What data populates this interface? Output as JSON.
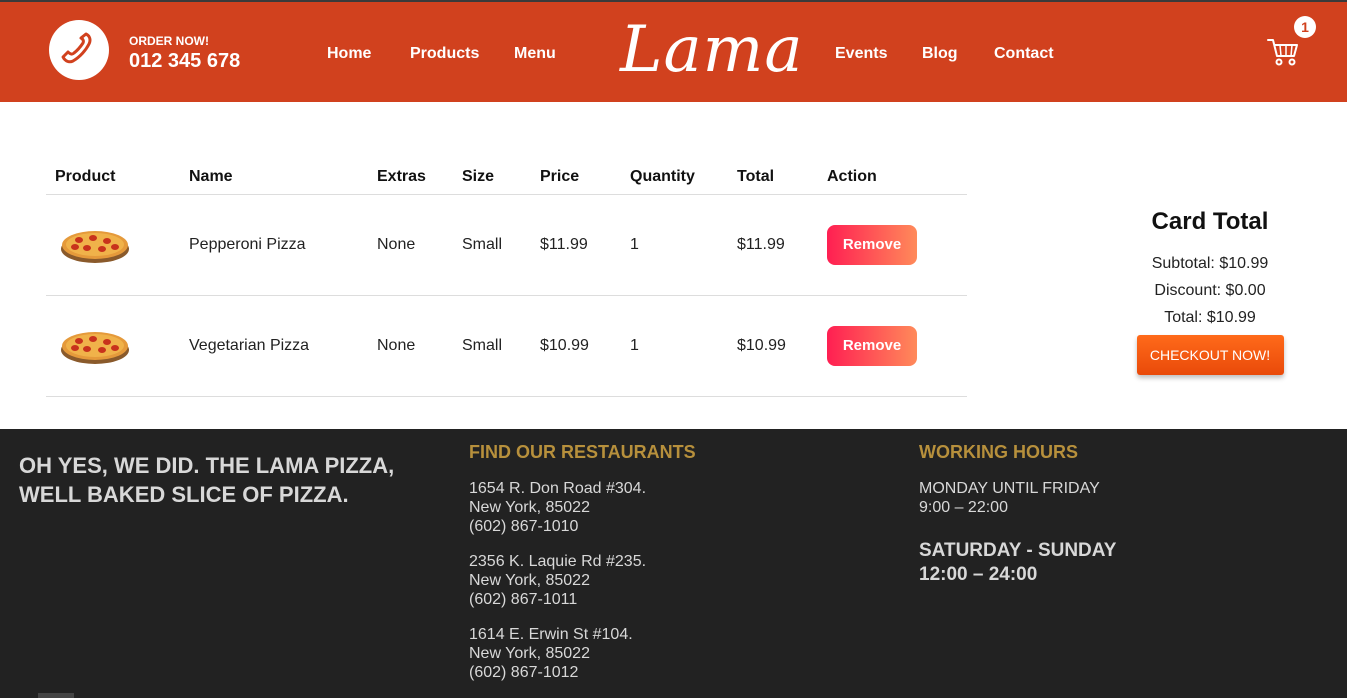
{
  "navbar": {
    "order_label": "ORDER NOW!",
    "phone": "012 345 678",
    "links_left": [
      "Home",
      "Products",
      "Menu"
    ],
    "logo": "Lama",
    "links_right": [
      "Events",
      "Blog",
      "Contact"
    ],
    "cart_count": "1",
    "colors": {
      "background": "#d1411e",
      "text": "#ffffff"
    },
    "icons": [
      "phone-icon",
      "cart-icon"
    ]
  },
  "cart": {
    "headers": [
      "Product",
      "Name",
      "Extras",
      "Size",
      "Price",
      "Quantity",
      "Total",
      "Action"
    ],
    "items": [
      {
        "name": "Pepperoni Pizza",
        "extras": "None",
        "size": "Small",
        "price": "$11.99",
        "quantity": "1",
        "total": "$11.99",
        "action": "Remove"
      },
      {
        "name": "Vegetarian Pizza",
        "extras": "None",
        "size": "Small",
        "price": "$10.99",
        "quantity": "1",
        "total": "$10.99",
        "action": "Remove"
      }
    ]
  },
  "summary": {
    "title": "Card Total",
    "subtotal": "Subtotal: $10.99",
    "discount": "Discount: $0.00",
    "total": "Total: $10.99",
    "checkout": "CHECKOUT NOW!"
  },
  "footer": {
    "slogan": "OH YES, WE DID. THE LAMA PIZZA, WELL BAKED SLICE OF PIZZA.",
    "restaurants_title": "FIND OUR RESTAURANTS",
    "restaurants": [
      {
        "street": "1654 R. Don Road #304.",
        "city": "New York, 85022",
        "phone": "(602) 867-1010"
      },
      {
        "street": "2356 K. Laquie Rd #235.",
        "city": "New York, 85022",
        "phone": "(602) 867-1011"
      },
      {
        "street": "1614 E. Erwin St #104.",
        "city": "New York, 85022",
        "phone": "(602) 867-1012"
      }
    ],
    "hours_title": "WORKING HOURS",
    "weekday_label": "MONDAY UNTIL FRIDAY",
    "weekday_hours": "9:00 – 22:00",
    "weekend_label": "SATURDAY - SUNDAY",
    "weekend_hours": "12:00 – 24:00",
    "colors": {
      "background": "#222222",
      "heading": "#b7903c"
    }
  }
}
